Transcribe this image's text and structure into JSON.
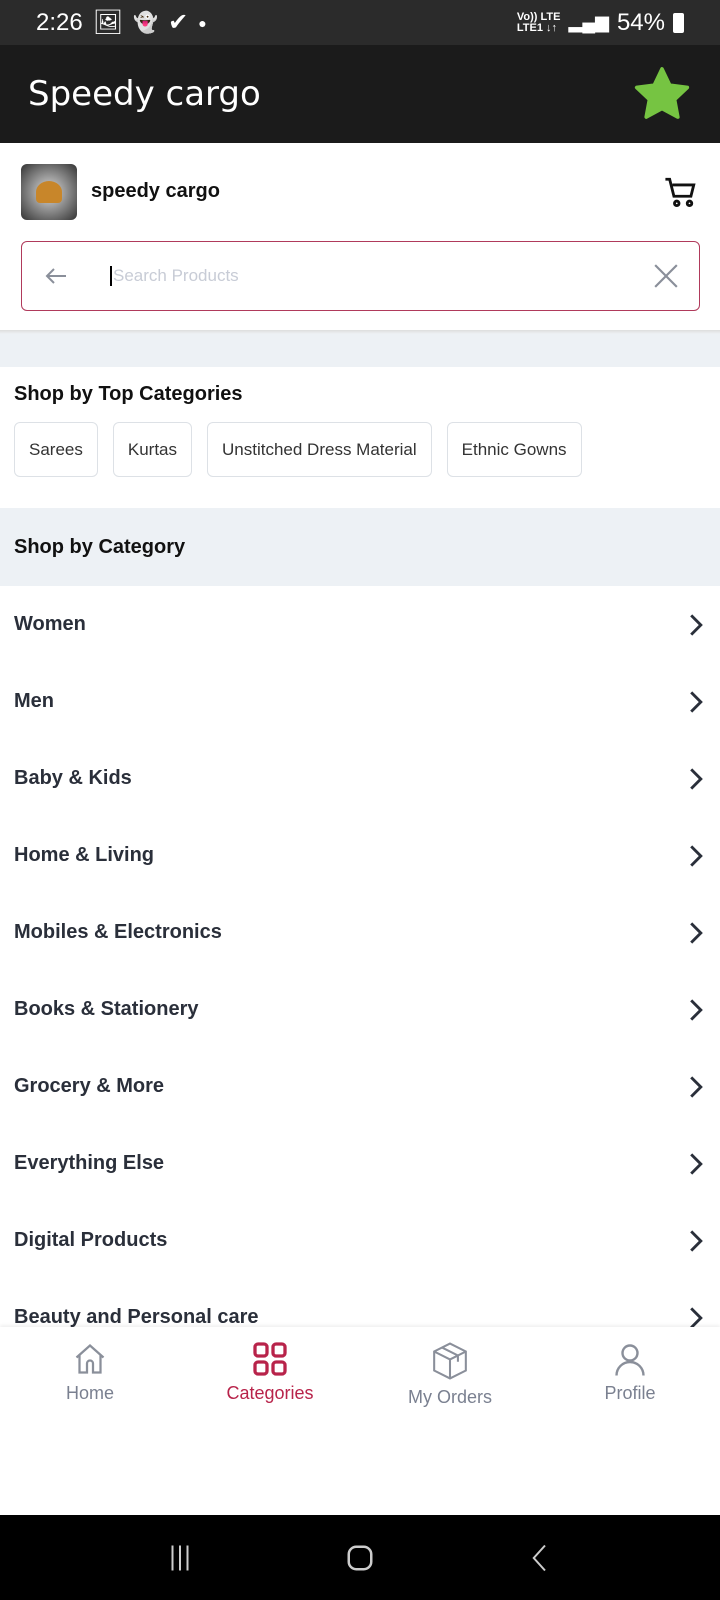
{
  "status_bar": {
    "time": "2:26",
    "network_top": "Vo)) LTE",
    "network_bottom": "LTE1 ↓↑",
    "battery": "54%"
  },
  "app_bar": {
    "title": "Speedy cargo",
    "star_color": "#76c442"
  },
  "store": {
    "name": "speedy cargo"
  },
  "search": {
    "placeholder": "Search Products",
    "value": ""
  },
  "top_categories": {
    "heading": "Shop by Top Categories",
    "chips": [
      "Sarees",
      "Kurtas",
      "Unstitched Dress Material",
      "Ethnic Gowns"
    ]
  },
  "categories": {
    "heading": "Shop by Category",
    "items": [
      "Women",
      "Men",
      "Baby & Kids",
      "Home & Living",
      "Mobiles & Electronics",
      "Books & Stationery",
      "Grocery & More",
      "Everything Else",
      "Digital Products",
      "Beauty and Personal care"
    ]
  },
  "bottom_nav": {
    "items": [
      {
        "label": "Home",
        "icon": "home-icon"
      },
      {
        "label": "Categories",
        "icon": "grid-icon",
        "active": true
      },
      {
        "label": "My Orders",
        "icon": "box-icon"
      },
      {
        "label": "Profile",
        "icon": "user-icon"
      }
    ],
    "active_color": "#b8234a"
  }
}
